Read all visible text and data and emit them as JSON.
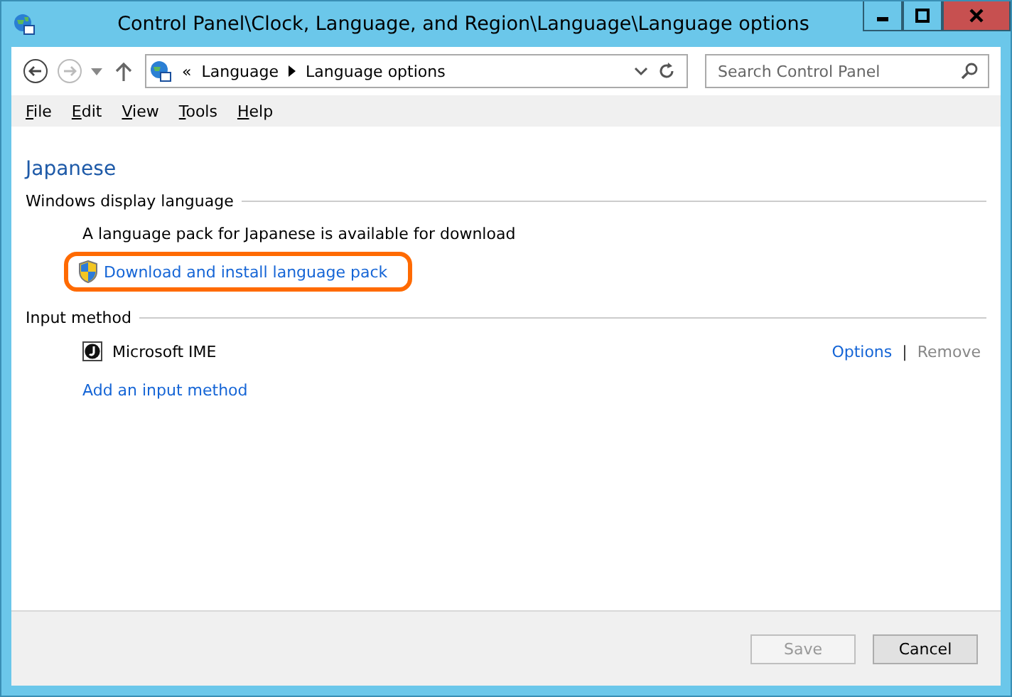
{
  "window": {
    "title": "Control Panel\\Clock, Language, and Region\\Language\\Language options"
  },
  "navigation": {
    "back_disabled": false,
    "forward_disabled": true
  },
  "address_bar": {
    "overflow": "«",
    "crumbs": [
      "Language",
      "Language options"
    ]
  },
  "search": {
    "placeholder": "Search Control Panel"
  },
  "menu": [
    "File",
    "Edit",
    "View",
    "Tools",
    "Help"
  ],
  "heading": "Japanese",
  "sections": [
    {
      "title": "Windows display language",
      "kind": "display",
      "message": "A language pack for Japanese is available for download",
      "link": {
        "label": "Download and install language pack",
        "highlighted": true
      }
    },
    {
      "title": "Input method",
      "kind": "input",
      "methods": [
        {
          "name": "Microsoft IME",
          "actions": [
            {
              "label": "Options",
              "disabled": false
            },
            {
              "label": "Remove",
              "disabled": true
            }
          ],
          "separator": "|"
        }
      ],
      "link": {
        "label": "Add an input method",
        "highlighted": false
      }
    }
  ],
  "buttons": [
    {
      "label": "Save",
      "disabled": true
    },
    {
      "label": "Cancel",
      "disabled": false
    }
  ]
}
